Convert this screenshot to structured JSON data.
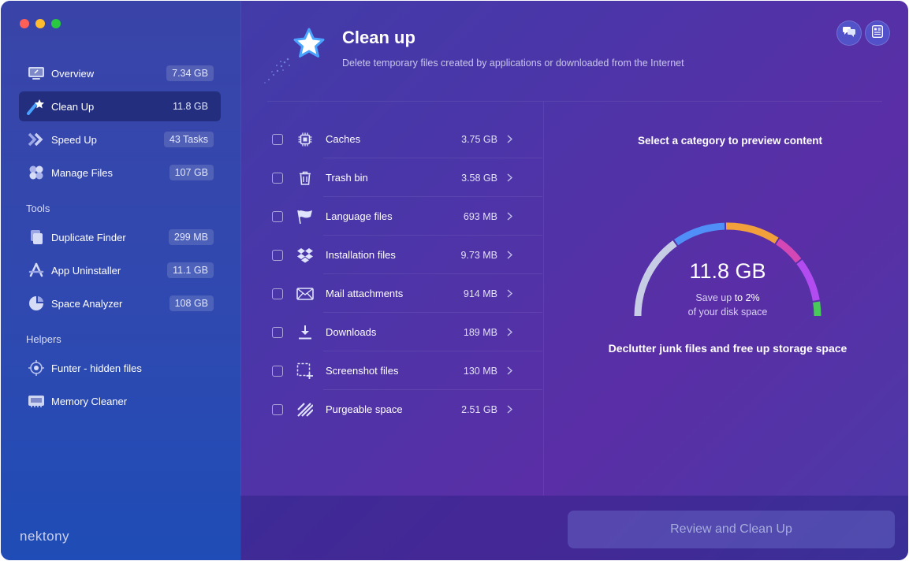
{
  "window": {
    "traffic_lights": [
      "close",
      "minimize",
      "zoom"
    ]
  },
  "sidebar": {
    "items": [
      {
        "label": "Overview",
        "badge": "7.34 GB",
        "icon": "monitor-icon",
        "active": false
      },
      {
        "label": "Clean Up",
        "badge": "11.8 GB",
        "icon": "shooting-star-icon",
        "active": true
      },
      {
        "label": "Speed Up",
        "badge": "43 Tasks",
        "icon": "double-chevron-icon",
        "active": false
      },
      {
        "label": "Manage Files",
        "badge": "107 GB",
        "icon": "hexagons-icon",
        "active": false
      }
    ],
    "tools_heading": "Tools",
    "tools": [
      {
        "label": "Duplicate Finder",
        "badge": "299 MB",
        "icon": "duplicate-files-icon"
      },
      {
        "label": "App Uninstaller",
        "badge": "11.1 GB",
        "icon": "app-store-icon"
      },
      {
        "label": "Space Analyzer",
        "badge": "108 GB",
        "icon": "pie-chart-icon"
      }
    ],
    "helpers_heading": "Helpers",
    "helpers": [
      {
        "label": "Funter - hidden files",
        "icon": "funter-icon"
      },
      {
        "label": "Memory Cleaner",
        "icon": "memory-chip-icon"
      }
    ],
    "brand": "nektony"
  },
  "header": {
    "title": "Clean up",
    "subtitle": "Delete temporary files created by applications or downloaded from the Internet"
  },
  "categories": [
    {
      "label": "Caches",
      "size": "3.75 GB",
      "icon": "chip-icon"
    },
    {
      "label": "Trash bin",
      "size": "3.58 GB",
      "icon": "trash-icon"
    },
    {
      "label": "Language files",
      "size": "693 MB",
      "icon": "flag-icon"
    },
    {
      "label": "Installation files",
      "size": "9.73 MB",
      "icon": "dropbox-icon"
    },
    {
      "label": "Mail attachments",
      "size": "914 MB",
      "icon": "mail-icon"
    },
    {
      "label": "Downloads",
      "size": "189 MB",
      "icon": "download-icon"
    },
    {
      "label": "Screenshot files",
      "size": "130 MB",
      "icon": "screenshot-icon"
    },
    {
      "label": "Purgeable space",
      "size": "2.51 GB",
      "icon": "stripes-icon"
    }
  ],
  "preview": {
    "title": "Select a category to preview content",
    "total": "11.8 GB",
    "save_prefix": "Save up",
    "save_amount": "to 2%",
    "save_suffix": "of your disk space",
    "caption": "Declutter junk files and free up storage space",
    "gauge_colors": [
      "#c8cde6",
      "#4f8ff7",
      "#f2a03c",
      "#d348b5",
      "#b24cf0",
      "#48c95a"
    ]
  },
  "action": {
    "label": "Review and Clean Up"
  }
}
